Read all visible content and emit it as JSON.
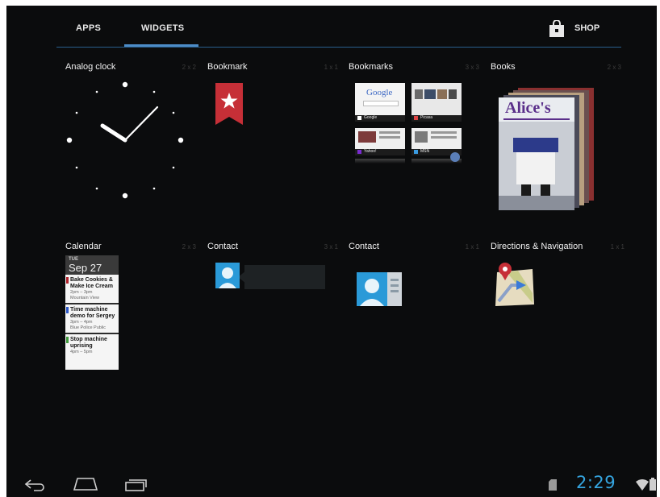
{
  "tabs": {
    "apps": "APPS",
    "widgets": "WIDGETS",
    "shop": "SHOP"
  },
  "widgets": [
    {
      "name": "Analog clock",
      "size": "2 x 2"
    },
    {
      "name": "Bookmark",
      "size": "1 x 1"
    },
    {
      "name": "Bookmarks",
      "size": "3 x 3"
    },
    {
      "name": "Books",
      "size": "2 x 3"
    },
    {
      "name": "Calendar",
      "size": "2 x 3"
    },
    {
      "name": "Contact",
      "size": "3 x 1"
    },
    {
      "name": "Contact",
      "size": "1 x 1"
    },
    {
      "name": "Directions & Navigation",
      "size": "1 x 1"
    }
  ],
  "bookmarks_preview": {
    "logo": "Google",
    "labels": [
      "Google",
      "Picasa",
      "Yahoo!",
      "MSN"
    ]
  },
  "books_preview": {
    "title": "Alice's"
  },
  "calendar_preview": {
    "dow": "TUE",
    "date": "Sep 27",
    "events": [
      {
        "title": "Bake Cookies & Make Ice Cream",
        "time": "2pm – 3pm",
        "place": "Mountain View"
      },
      {
        "title": "Time machine demo for Sergey",
        "time": "3pm – 4pm",
        "place": "Blue Police Public"
      },
      {
        "title": "Stop machine uprising",
        "time": "4pm – 5pm",
        "place": ""
      }
    ]
  },
  "status": {
    "time": "2:29"
  },
  "colors": {
    "accent": "#4d8cc7",
    "clock": "#35a5e0",
    "bookmark": "#c62f37",
    "background": "#0b0c0d"
  },
  "icons": [
    "shop-bag-icon",
    "back-icon",
    "home-icon",
    "recent-apps-icon",
    "sd-card-icon",
    "wifi-icon",
    "battery-icon"
  ]
}
